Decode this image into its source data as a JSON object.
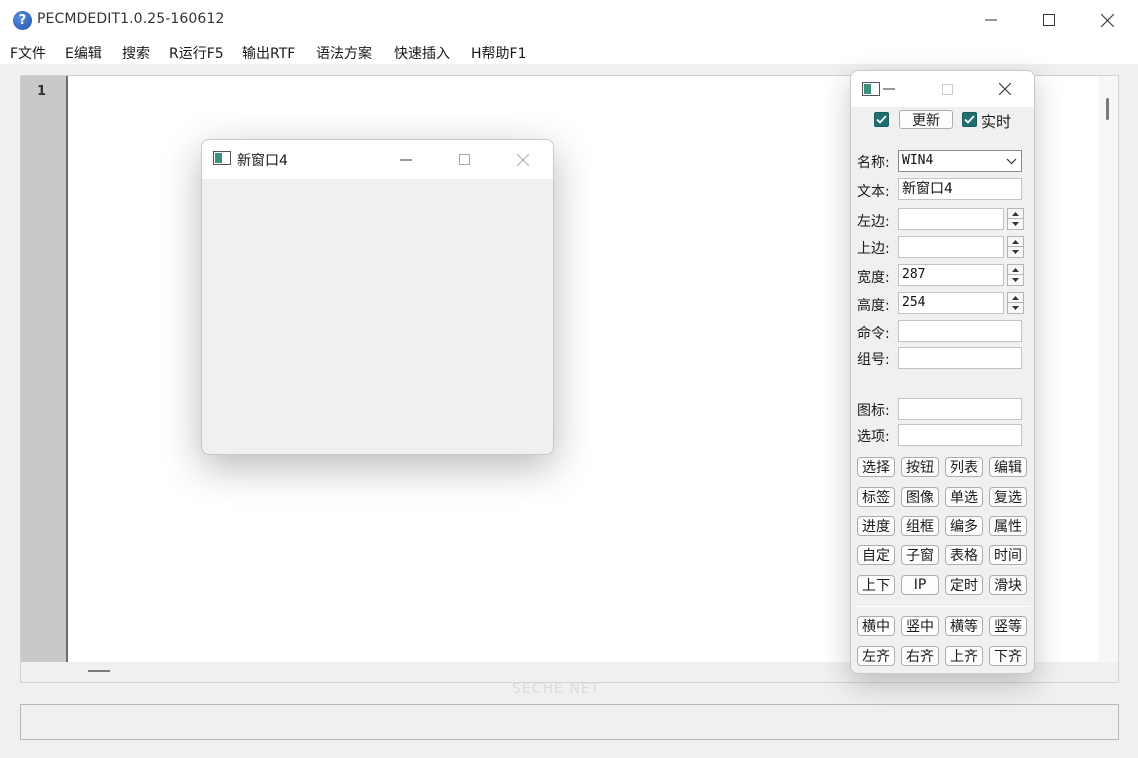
{
  "app": {
    "title": "PECMDEDIT1.0.25-160612",
    "icon": "help-question-icon"
  },
  "menu": {
    "items": [
      "F文件",
      "E编辑",
      "搜索",
      "R运行F5",
      "输出RTF",
      "语法方案",
      "快速插入",
      "H帮助F1"
    ]
  },
  "editor": {
    "line_number": "1"
  },
  "preview_window": {
    "title": "新窗口4"
  },
  "panel": {
    "update_button": "更新",
    "realtime_label": "实时",
    "fields": {
      "name_label": "名称:",
      "name_value": "WIN4",
      "text_label": "文本:",
      "text_value": "新窗口4",
      "left_label": "左边:",
      "left_value": "",
      "top_label": "上边:",
      "top_value": "",
      "width_label": "宽度:",
      "width_value": "287",
      "height_label": "高度:",
      "height_value": "254",
      "command_label": "命令:",
      "command_value": "",
      "group_label": "组号:",
      "group_value": "",
      "icon_label": "图标:",
      "icon_value": "",
      "options_label": "选项:",
      "options_value": ""
    },
    "tool_buttons": [
      [
        "选择",
        "按钮",
        "列表",
        "编辑"
      ],
      [
        "标签",
        "图像",
        "单选",
        "复选"
      ],
      [
        "进度",
        "组框",
        "编多",
        "属性"
      ],
      [
        "自定",
        "子窗",
        "表格",
        "时间"
      ],
      [
        "上下",
        "IP",
        "定时",
        "滑块"
      ]
    ],
    "align_buttons": [
      [
        "横中",
        "竖中",
        "横等",
        "竖等"
      ],
      [
        "左齐",
        "右齐",
        "上齐",
        "下齐"
      ]
    ]
  },
  "watermark": "SECHE NET",
  "colors": {
    "checkbox": "#1f6f6f",
    "gutter": "#c9c9c9",
    "window_bg": "#f0f0f0"
  }
}
